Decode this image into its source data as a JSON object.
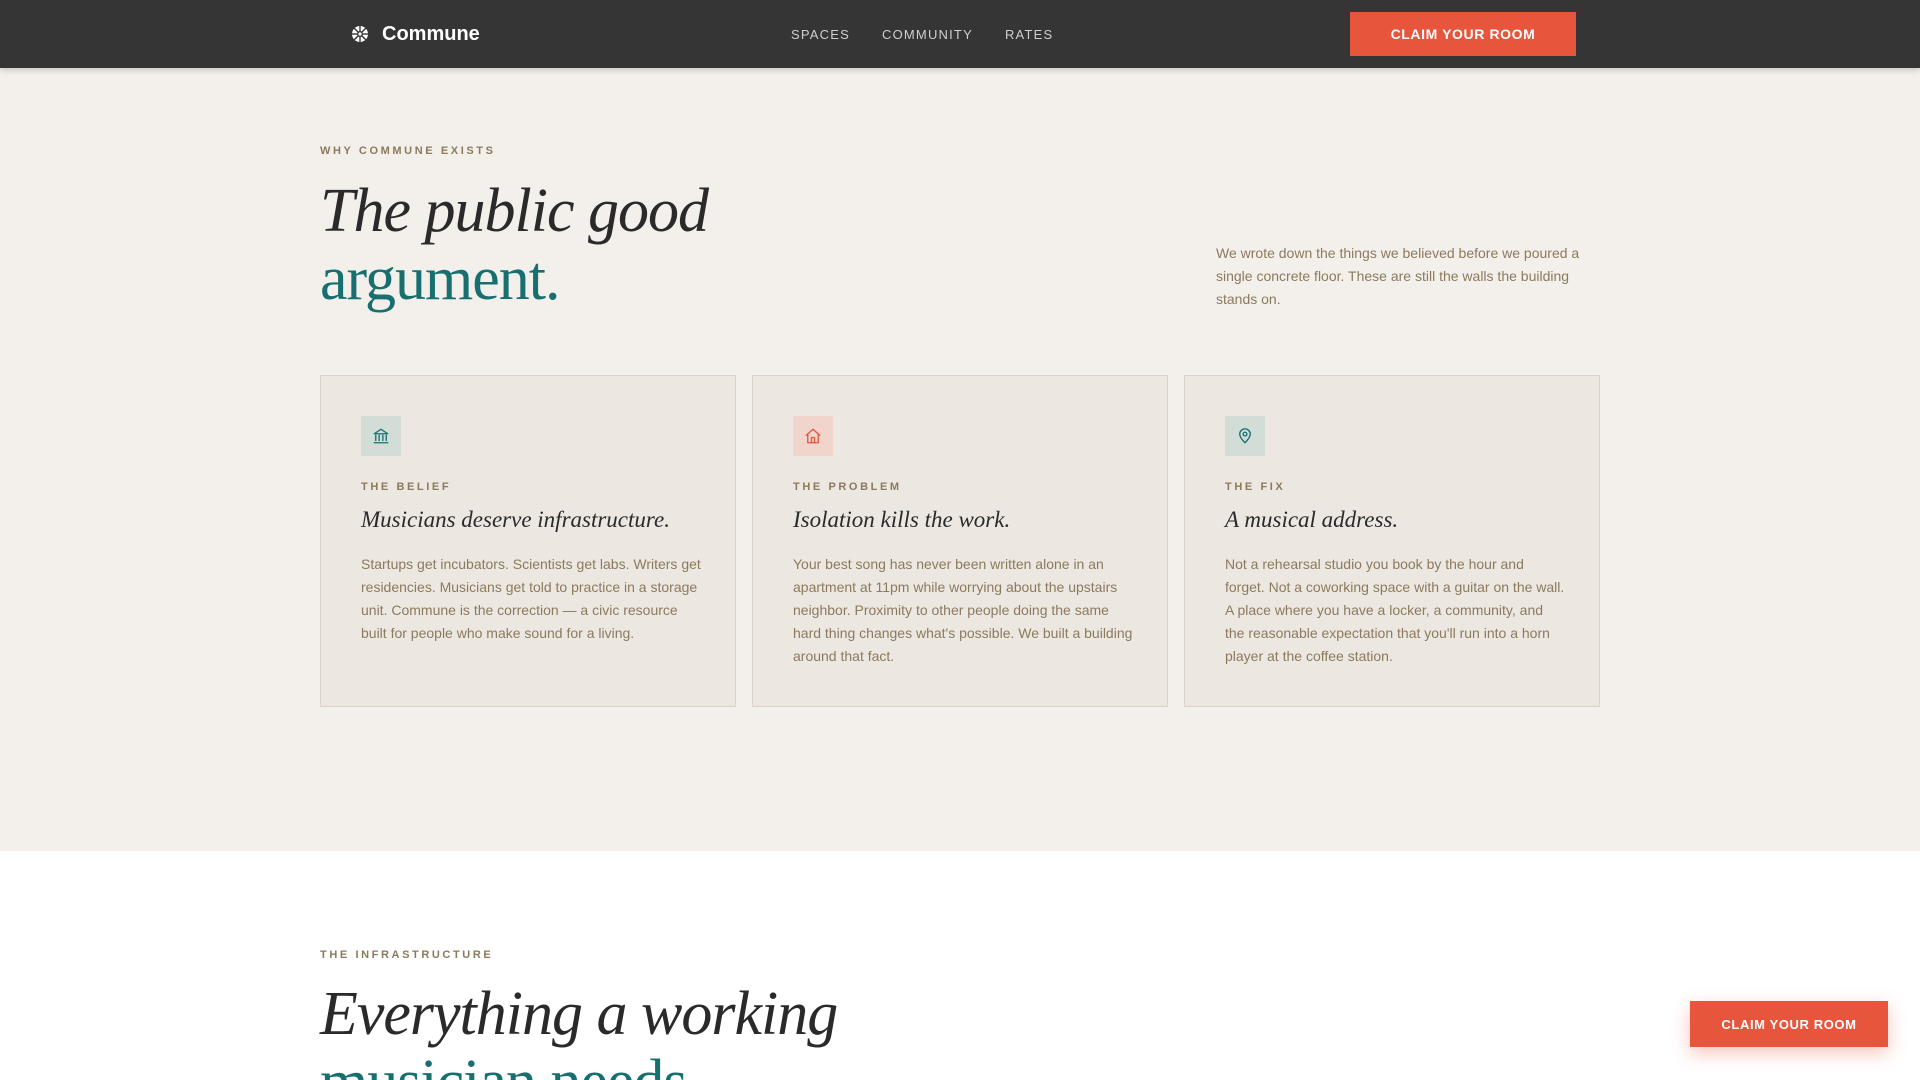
{
  "brand": {
    "name": "Commune",
    "icon": "compass-icon"
  },
  "nav": {
    "items": [
      {
        "label": "SPACES"
      },
      {
        "label": "COMMUNITY"
      },
      {
        "label": "RATES"
      }
    ]
  },
  "header": {
    "cta_label": "CLAIM YOUR ROOM"
  },
  "why": {
    "eyebrow": "WHY COMMUNE EXISTS",
    "title_line1": "The public good",
    "title_line2": "argument.",
    "intro": "We wrote down the things we believed before we poured a single concrete floor. These are still the walls the building stands on.",
    "cards": [
      {
        "icon": "institution-icon",
        "label": "THE BELIEF",
        "title": "Musicians deserve infrastructure.",
        "body": "Startups get incubators. Scientists get labs. Writers get residencies. Musicians get told to practice in a storage unit. Commune is the correction — a civic resource built for people who make sound for a living."
      },
      {
        "icon": "house-icon",
        "label": "THE PROBLEM",
        "title": "Isolation kills the work.",
        "body": "Your best song has never been written alone in an apartment at 11pm while worrying about the upstairs neighbor. Proximity to other people doing the same hard thing changes what's possible. We built a building around that fact."
      },
      {
        "icon": "location-pin-icon",
        "label": "THE FIX",
        "title": "A musical address.",
        "body": "Not a rehearsal studio you book by the hour and forget. Not a coworking space with a guitar on the wall. A place where you have a locker, a community, and the reasonable expectation that you'll run into a horn player at the coffee station."
      }
    ]
  },
  "infrastructure": {
    "eyebrow": "THE INFRASTRUCTURE",
    "title_line1": "Everything a working",
    "title_line2": "musician needs."
  },
  "floating_cta": {
    "label": "CLAIM YOUR ROOM"
  },
  "colors": {
    "accent": "#e8553d",
    "teal": "#17706f",
    "header_bg": "#353535",
    "page_bg": "#f3f0eb",
    "muted_text": "#8b7a5e"
  }
}
